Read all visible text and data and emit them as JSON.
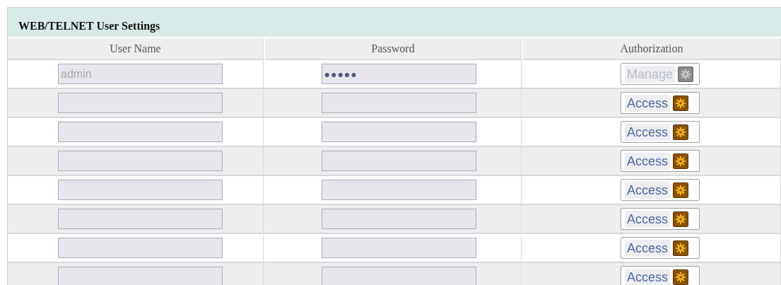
{
  "panel": {
    "title": "WEB/TELNET User Settings"
  },
  "columns": [
    "User Name",
    "Password",
    "Authorization"
  ],
  "rows": [
    {
      "user_name": "admin",
      "password": "●●●●●",
      "authorization": "Manage",
      "auth_disabled": true
    },
    {
      "user_name": "",
      "password": "",
      "authorization": "Access",
      "auth_disabled": false
    },
    {
      "user_name": "",
      "password": "",
      "authorization": "Access",
      "auth_disabled": false
    },
    {
      "user_name": "",
      "password": "",
      "authorization": "Access",
      "auth_disabled": false
    },
    {
      "user_name": "",
      "password": "",
      "authorization": "Access",
      "auth_disabled": false
    },
    {
      "user_name": "",
      "password": "",
      "authorization": "Access",
      "auth_disabled": false
    },
    {
      "user_name": "",
      "password": "",
      "authorization": "Access",
      "auth_disabled": false
    },
    {
      "user_name": "",
      "password": "",
      "authorization": "Access",
      "auth_disabled": false
    }
  ]
}
